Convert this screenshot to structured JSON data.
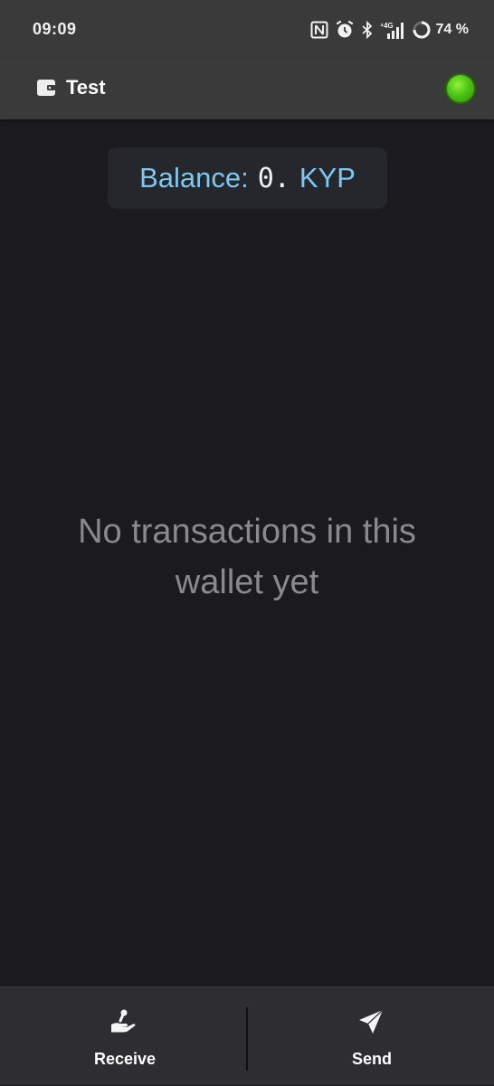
{
  "status_bar": {
    "time": "09:09",
    "battery": "74 %",
    "icons": [
      "nfc-icon",
      "alarm-icon",
      "bluetooth-icon",
      "signal-4g-icon",
      "battery-ring-icon"
    ]
  },
  "app_bar": {
    "title": "Test",
    "icon": "wallet-icon",
    "connection_status_color": "#4fc414"
  },
  "balance": {
    "label": "Balance:",
    "amount": "0.",
    "unit": "KYP"
  },
  "empty_state": {
    "line1": "No transactions in this",
    "line2": "wallet yet"
  },
  "bottom_bar": {
    "receive_label": "Receive",
    "send_label": "Send"
  },
  "colors": {
    "background": "#1b1b1f",
    "bar": "#3a3a3a",
    "accent": "#7cc8ef",
    "muted_text": "#8a8a8a"
  }
}
